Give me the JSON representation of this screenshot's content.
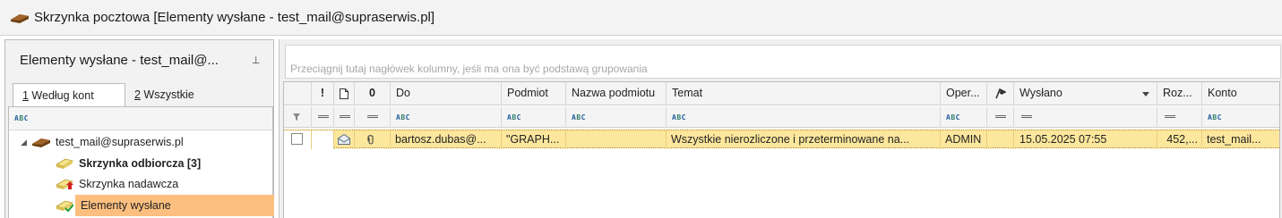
{
  "window": {
    "title": "Skrzynka pocztowa [Elementy wysłane - test_mail@supraserwis.pl]"
  },
  "left_panel": {
    "title": "Elementy wysłane - test_mail@...",
    "pin_glyph": "⊥",
    "tabs": [
      {
        "key": "1",
        "label": " Według kont",
        "active": true
      },
      {
        "key": "2",
        "label": " Wszystkie",
        "active": false
      }
    ],
    "filter_icon": "abc-filter-icon",
    "tree": {
      "account": "test_mail@supraserwis.pl",
      "folders": [
        {
          "label": "Skrzynka odbiorcza [3]",
          "bold": true,
          "icon": "inbox-folder-icon"
        },
        {
          "label": "Skrzynka nadawcza",
          "bold": false,
          "icon": "outbox-folder-icon"
        },
        {
          "label": "Elementy wysłane",
          "bold": false,
          "selected": true,
          "icon": "sent-folder-icon"
        }
      ]
    }
  },
  "grid": {
    "group_hint": "Przeciągnij tutaj nagłówek kolumny, jeśli ma ona być podstawą grupowania",
    "columns": {
      "flag": "!",
      "attachment": "0",
      "do": "Do",
      "podmiot": "Podmiot",
      "nazwa_podmiotu": "Nazwa podmiotu",
      "temat": "Temat",
      "operator": "Oper...",
      "wyslano": "Wysłano",
      "rozmiar": "Roz...",
      "konto": "Konto"
    },
    "rows": [
      {
        "do": "bartosz.dubas@...",
        "podmiot": "\"GRAPH...",
        "nazwa_podmiotu": "",
        "temat": "Wszystkie nierozliczone i przeterminowane na...",
        "operator": "ADMIN",
        "wyslano": "15.05.2025 07:55",
        "rozmiar": "452,...",
        "konto": "test_mail..."
      }
    ]
  },
  "colors": {
    "selected_folder": "#fcbf7f",
    "selected_row": "#fde79c"
  }
}
